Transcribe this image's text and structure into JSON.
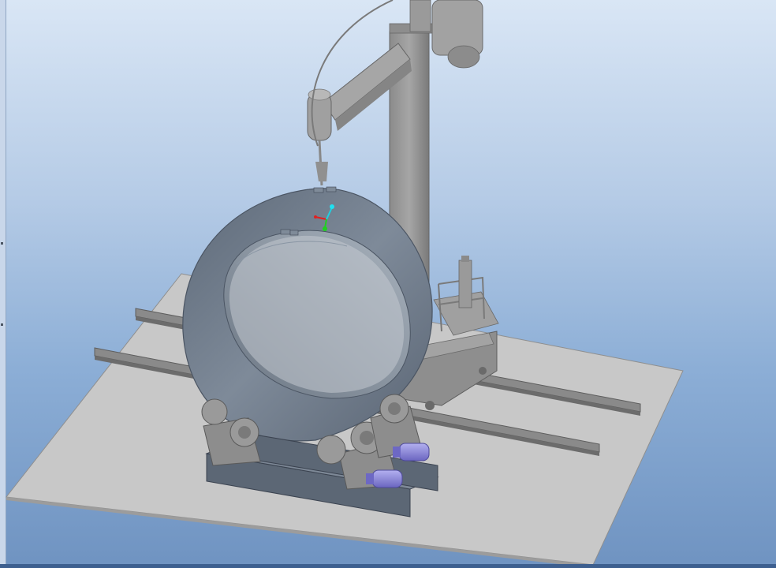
{
  "viewport": {
    "background_top": "#d9e6f5",
    "background_bottom": "#6f93c1"
  },
  "scene": {
    "objects": [
      "floor-plate",
      "rails",
      "welding-manipulator",
      "pipe-shell",
      "roller-supports",
      "drive-motors",
      "coordinate-triad"
    ]
  },
  "colors": {
    "floor": "#c8c8c8",
    "shell": "#7b8795",
    "machine": "#9a9a9a",
    "motor": "#8a86d6",
    "axis_x": "#e02020",
    "axis_y": "#20d020",
    "axis_z": "#20d0e0"
  }
}
